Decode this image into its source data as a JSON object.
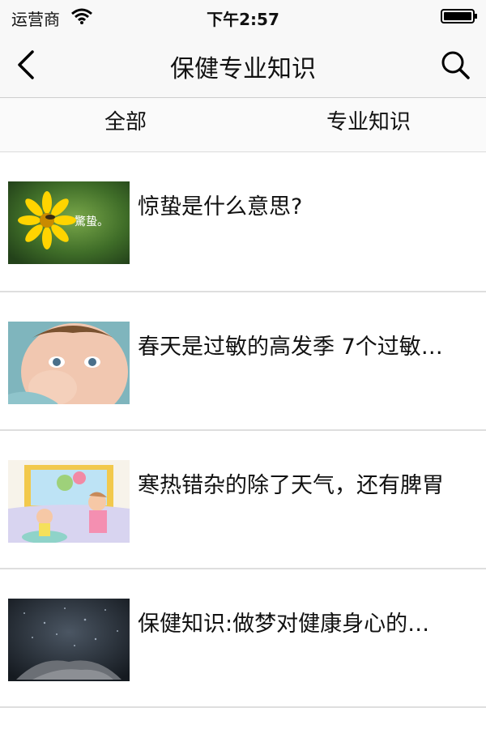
{
  "status_bar": {
    "carrier": "运营商",
    "time": "下午2:57"
  },
  "nav": {
    "title": "保健专业知识"
  },
  "tabs": [
    {
      "label": "全部"
    },
    {
      "label": "专业知识"
    }
  ],
  "articles": [
    {
      "title": "惊蛰是什么意思?",
      "thumb_text": "驚蛰。"
    },
    {
      "title": "春天是过敏的高发季 7个过敏…"
    },
    {
      "title": "寒热错杂的除了天气，还有脾胃"
    },
    {
      "title": "保健知识:做梦对健康身心的…"
    }
  ],
  "colors": {
    "bar_bg": "#f8f8f8",
    "divider": "#dedede",
    "text": "#111111"
  },
  "icons": [
    "wifi-icon",
    "battery-icon",
    "back-chevron-icon",
    "search-icon"
  ]
}
